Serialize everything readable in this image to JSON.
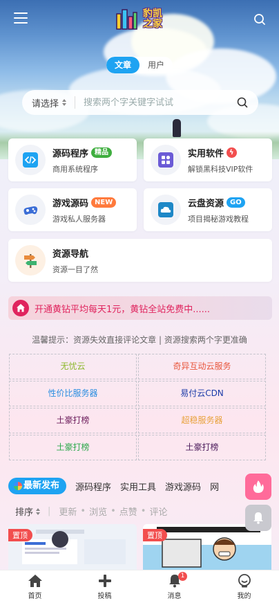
{
  "header": {
    "logo_text_line1": "豹凯",
    "logo_text_line2": "之家"
  },
  "segment": {
    "tabs": [
      "文章",
      "用户"
    ],
    "active": 0
  },
  "search": {
    "select_label": "请选择",
    "placeholder": "搜索两个字关键字试试"
  },
  "cards": [
    {
      "title": "源码程序",
      "badge": "精品",
      "badge_color": "#3fae3f",
      "subtitle": "商用系统程序",
      "icon": "code-icon",
      "icon_color": "#1ea3f2"
    },
    {
      "title": "实用软件",
      "badge": "ϟ",
      "badge_color": "#f24e4e",
      "subtitle": "解锁黑科技VIP软件",
      "icon": "apps-icon",
      "icon_color": "#6b5bd6"
    },
    {
      "title": "游戏源码",
      "badge": "NEW",
      "badge_color": "#ff7a3c",
      "subtitle": "游戏私人服务器",
      "icon": "gamepad-icon",
      "icon_color": "#3c6ed6"
    },
    {
      "title": "云盘资源",
      "badge": "GO",
      "badge_color": "#1ea3f2",
      "subtitle": "项目揭秘游戏教程",
      "icon": "cloud-icon",
      "icon_color": "#1e88c7"
    },
    {
      "title": "资源导航",
      "badge": "",
      "badge_color": "",
      "subtitle": "资源一目了然",
      "icon": "signpost-icon",
      "icon_color": "#e88b3c"
    }
  ],
  "notice": {
    "text": "开通黄钻平均每天1元，黄钻全站免费中......"
  },
  "tip": {
    "text": "温馨提示：资源失效直接评论文章 | 资源搜索两个字更准确"
  },
  "links": [
    {
      "label": "无忧云",
      "color": "#8bb82a"
    },
    {
      "label": "奇异互动云服务",
      "color": "#e8563c"
    },
    {
      "label": "性价比服务器",
      "color": "#2a8ee0"
    },
    {
      "label": "易付云CDN",
      "color": "#1a3aa8"
    },
    {
      "label": "土豪打榜",
      "color": "#6a1a5a"
    },
    {
      "label": "超稳服务器",
      "color": "#e8a23c"
    },
    {
      "label": "土豪打榜",
      "color": "#2aa84a"
    },
    {
      "label": "土豪打榜",
      "color": "#4a1a5a"
    }
  ],
  "tabs": {
    "active": "最新发布",
    "items": [
      "源码程序",
      "实用工具",
      "游戏源码",
      "网"
    ]
  },
  "sortbar": {
    "sort_label": "排序",
    "options": [
      "更新",
      "浏览",
      "点赞",
      "评论"
    ]
  },
  "thumbs": {
    "pin_label": "置顶"
  },
  "bottom_nav": {
    "items": [
      {
        "label": "首页",
        "icon": "home-icon"
      },
      {
        "label": "投稿",
        "icon": "plus-icon"
      },
      {
        "label": "消息",
        "icon": "bell-icon",
        "badge": "1"
      },
      {
        "label": "我的",
        "icon": "user-icon"
      }
    ]
  }
}
